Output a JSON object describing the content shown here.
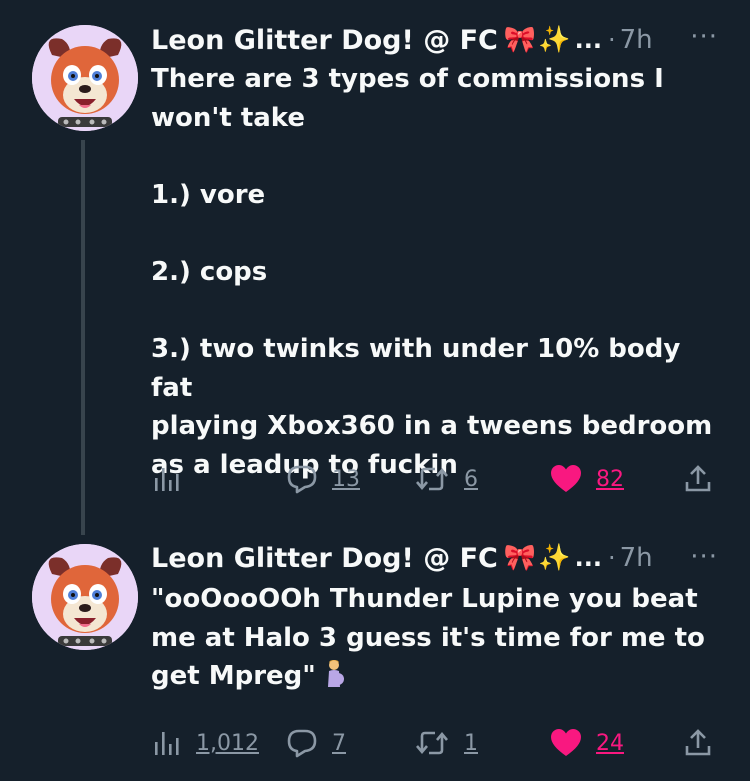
{
  "tweets": [
    {
      "author": "Leon Glitter Dog! @ FC",
      "ellipsis": "...",
      "separator": "·",
      "time": "7h",
      "more_label": "···",
      "text": "There are 3 types of commissions I\nwon't take\n\n1.) vore\n\n2.) cops\n\n3.) two twinks with under 10% body fat\nplaying Xbox360 in a tweens bedroom\nas a leadup to fuckin",
      "stats": {
        "views": "",
        "replies": "13",
        "retweets": "6",
        "likes": "82"
      }
    },
    {
      "author": "Leon Glitter Dog! @ FC",
      "ellipsis": "...",
      "separator": "·",
      "time": "7h",
      "more_label": "···",
      "text": "\"ooOooOOh Thunder Lupine you beat\nme at Halo 3 guess it's time for me to\nget Mpreg\"",
      "stats": {
        "views": "1,012",
        "replies": "7",
        "retweets": "1",
        "likes": "24"
      }
    }
  ],
  "icons": {
    "ribbon": "🎀",
    "sparkles": "✨",
    "analytics": "analytics-icon",
    "reply": "reply-icon",
    "retweet": "retweet-icon",
    "like": "heart-icon",
    "share": "share-icon",
    "pregnant": "pregnant-person-emoji"
  },
  "colors": {
    "background": "#15202b",
    "text": "#f7f9f9",
    "muted": "#8b98a5",
    "like": "#f91880",
    "thread_line": "#38444d"
  }
}
